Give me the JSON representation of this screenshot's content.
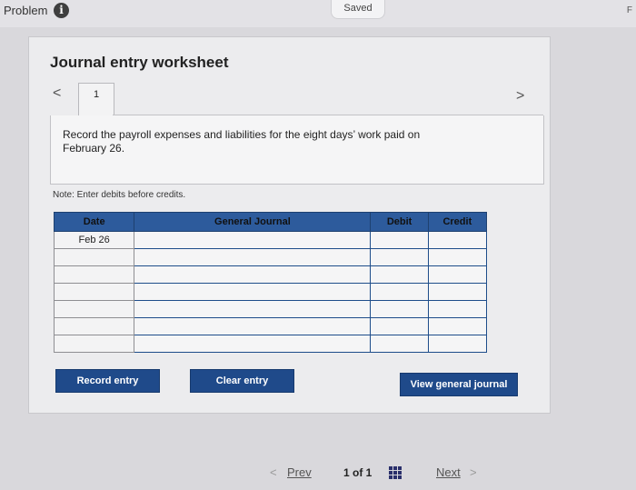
{
  "topbar": {
    "problem_label": "Problem",
    "info_icon": "i",
    "saved": "Saved",
    "edge_glyph": "F"
  },
  "worksheet": {
    "title": "Journal entry worksheet",
    "prev_arrow": "<",
    "next_arrow": ">",
    "tab_label": "1",
    "prompt": "Record the payroll expenses and liabilities for the eight days’ work paid on February 26.",
    "note": "Note: Enter debits before credits.",
    "table": {
      "headers": {
        "date": "Date",
        "general_journal": "General Journal",
        "debit": "Debit",
        "credit": "Credit"
      },
      "rows": [
        {
          "date": "Feb 26",
          "account": "",
          "debit": "",
          "credit": ""
        },
        {
          "date": "",
          "account": "",
          "debit": "",
          "credit": ""
        },
        {
          "date": "",
          "account": "",
          "debit": "",
          "credit": ""
        },
        {
          "date": "",
          "account": "",
          "debit": "",
          "credit": ""
        },
        {
          "date": "",
          "account": "",
          "debit": "",
          "credit": ""
        },
        {
          "date": "",
          "account": "",
          "debit": "",
          "credit": ""
        },
        {
          "date": "",
          "account": "",
          "debit": "",
          "credit": ""
        }
      ]
    },
    "buttons": {
      "record": "Record entry",
      "clear": "Clear entry",
      "view": "View general journal"
    }
  },
  "pager": {
    "prev": "Prev",
    "prev_arrow": "<",
    "count": "1 of 1",
    "next": "Next",
    "next_arrow": ">",
    "grid_icon": "grid-icon"
  },
  "colors": {
    "header_bg": "#2d5b9c",
    "button_bg": "#1f4a8a",
    "page_bg": "#d9d8dc"
  }
}
